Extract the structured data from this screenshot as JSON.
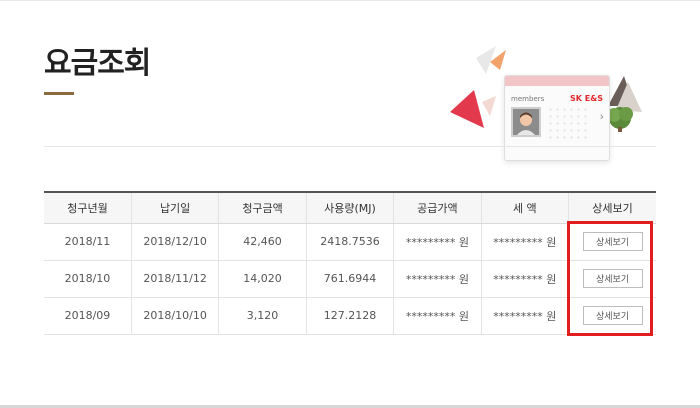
{
  "page": {
    "title": "요금조회"
  },
  "illustration": {
    "card_label": "members",
    "card_logo": "SK E&S"
  },
  "colors": {
    "title_accent": "#8b6a3e",
    "highlight": "#e01e1e",
    "triangle_red": "#e23a4c",
    "triangle_orange": "#f2a36b",
    "triangle_dark": "#6b5e58"
  },
  "table": {
    "headers": [
      "청구년월",
      "납기일",
      "청구금액",
      "사용량(MJ)",
      "공급가액",
      "세 액",
      "상세보기"
    ],
    "rows": [
      {
        "month": "2018/11",
        "due": "2018/12/10",
        "amount": "42,460",
        "usage": "2418.7536",
        "supply": "********* 원",
        "tax": "********* 원",
        "detail": "상세보기"
      },
      {
        "month": "2018/10",
        "due": "2018/11/12",
        "amount": "14,020",
        "usage": "761.6944",
        "supply": "********* 원",
        "tax": "********* 원",
        "detail": "상세보기"
      },
      {
        "month": "2018/09",
        "due": "2018/10/10",
        "amount": "3,120",
        "usage": "127.2128",
        "supply": "********* 원",
        "tax": "********* 원",
        "detail": "상세보기"
      }
    ]
  }
}
